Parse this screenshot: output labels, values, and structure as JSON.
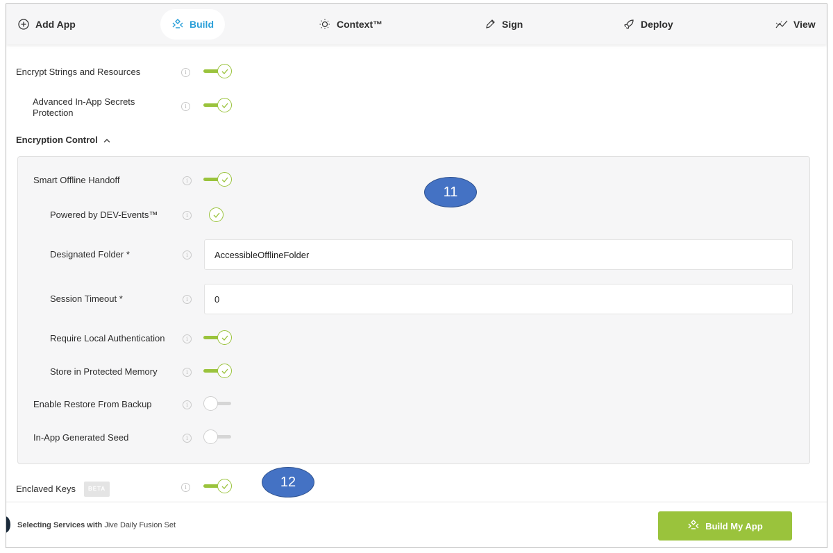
{
  "nav": {
    "items": [
      {
        "label": "Add App",
        "icon": "plus-circle-icon"
      },
      {
        "label": "Build",
        "icon": "build-icon",
        "active": true
      },
      {
        "label": "Context™",
        "icon": "lightbulb-icon"
      },
      {
        "label": "Sign",
        "icon": "pen-icon"
      },
      {
        "label": "Deploy",
        "icon": "rocket-icon"
      },
      {
        "label": "View",
        "icon": "chart-icon"
      }
    ],
    "active_color": "#2a9fd8"
  },
  "settings": {
    "encrypt_strings": {
      "label": "Encrypt Strings and Resources",
      "enabled": true
    },
    "advanced_secrets": {
      "label": "Advanced In-App Secrets Protection",
      "enabled": true
    },
    "encryption_control": {
      "label": "Encryption Control",
      "expanded": true
    },
    "smart_offline": {
      "label": "Smart Offline Handoff",
      "enabled": true
    },
    "powered_by": {
      "label": "Powered by DEV-Events™",
      "checked": true
    },
    "designated_folder": {
      "label": "Designated Folder  *",
      "value": "AccessibleOfflineFolder"
    },
    "session_timeout": {
      "label": "Session Timeout  *",
      "value": "0"
    },
    "require_local_auth": {
      "label": "Require Local Authentication",
      "enabled": true
    },
    "store_protected": {
      "label": "Store in Protected Memory",
      "enabled": true
    },
    "restore_backup": {
      "label": "Enable Restore From Backup",
      "enabled": false
    },
    "generated_seed": {
      "label": "In-App Generated Seed",
      "enabled": false
    },
    "enclaved_keys": {
      "label": "Enclaved Keys",
      "badge": "BETA",
      "enabled": true
    }
  },
  "annotations": {
    "callout_11": "11",
    "callout_12": "12"
  },
  "footer": {
    "prefix": "Selecting Services with",
    "set_name": " Jive Daily Fusion Set",
    "button_label": "Build My App"
  },
  "colors": {
    "accent_green": "#9ac33c",
    "callout_blue": "#4472c4"
  }
}
